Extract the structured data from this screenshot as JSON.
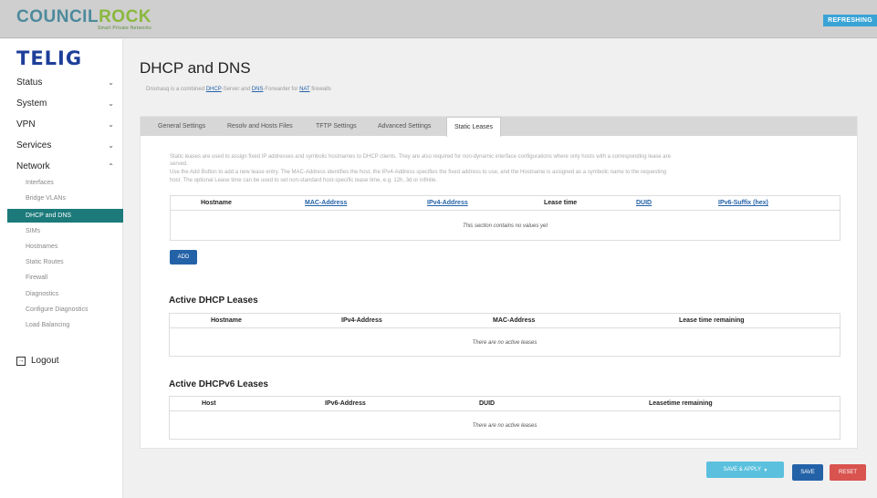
{
  "header": {
    "logo_part1": "COUNCIL",
    "logo_part2": "ROCK",
    "logo_tagline": "Smart Private Networks",
    "status_badge": "REFRESHING"
  },
  "sidebar": {
    "brand": "TELIG",
    "menu": [
      {
        "label": "Status"
      },
      {
        "label": "System"
      },
      {
        "label": "VPN"
      },
      {
        "label": "Services"
      },
      {
        "label": "Network"
      }
    ],
    "network_items": [
      {
        "label": "Interfaces"
      },
      {
        "label": "Bridge VLANs"
      },
      {
        "label": "DHCP and DNS"
      },
      {
        "label": "SIMs"
      },
      {
        "label": "Hostnames"
      },
      {
        "label": "Static Routes"
      },
      {
        "label": "Firewall"
      },
      {
        "label": "Diagnostics"
      },
      {
        "label": "Configure Diagnostics"
      },
      {
        "label": "Load Balancing"
      }
    ],
    "logout": "Logout"
  },
  "page": {
    "title": "DHCP and DNS",
    "desc_pre": "Dnsmasq is a combined ",
    "desc_link1": "DHCP",
    "desc_mid1": "-Server and ",
    "desc_link2": "DNS",
    "desc_mid2": "-Forwarder for ",
    "desc_link3": "NAT",
    "desc_post": " firewalls"
  },
  "tabs": [
    {
      "label": "General Settings"
    },
    {
      "label": "Resolv and Hosts Files"
    },
    {
      "label": "TFTP Settings"
    },
    {
      "label": "Advanced Settings"
    },
    {
      "label": "Static Leases"
    }
  ],
  "static_leases": {
    "help_line1": "Static leases are used to assign fixed IP addresses and symbolic hostnames to DHCP clients. They are also required for non-dynamic interface configurations where only hosts with a corresponding lease are",
    "help_line2": "served.",
    "help_line3": "Use the Add Button to add a new lease entry. The MAC-Address identifies the host, the IPv4-Address specifies the fixed address to use, and the Hostname is assigned as a symbolic name to the requesting",
    "help_line4": "host. The optional Lease time can be used to set non-standard host-specific lease time, e.g. 12h, 3d or infinite.",
    "columns": [
      "Hostname",
      "MAC-Address",
      "IPv4-Address",
      "Lease time",
      "DUID",
      "IPv6-Suffix (hex)"
    ],
    "empty": "This section contains no values yet",
    "add_button": "ADD"
  },
  "dhcp_leases": {
    "title": "Active DHCP Leases",
    "columns": [
      "Hostname",
      "IPv4-Address",
      "MAC-Address",
      "Lease time remaining"
    ],
    "empty": "There are no active leases"
  },
  "dhcpv6_leases": {
    "title": "Active DHCPv6 Leases",
    "columns": [
      "Host",
      "IPv6-Address",
      "DUID",
      "Leasetime remaining"
    ],
    "empty": "There are no active leases"
  },
  "actions": {
    "save_apply": "SAVE & APPLY",
    "save": "SAVE",
    "reset": "RESET"
  },
  "colors": {
    "accent": "#1c7a7b",
    "brand": "#1e3f99",
    "primary_button": "#2462a8",
    "danger_button": "#d9534f",
    "info_button": "#5bc0de"
  }
}
